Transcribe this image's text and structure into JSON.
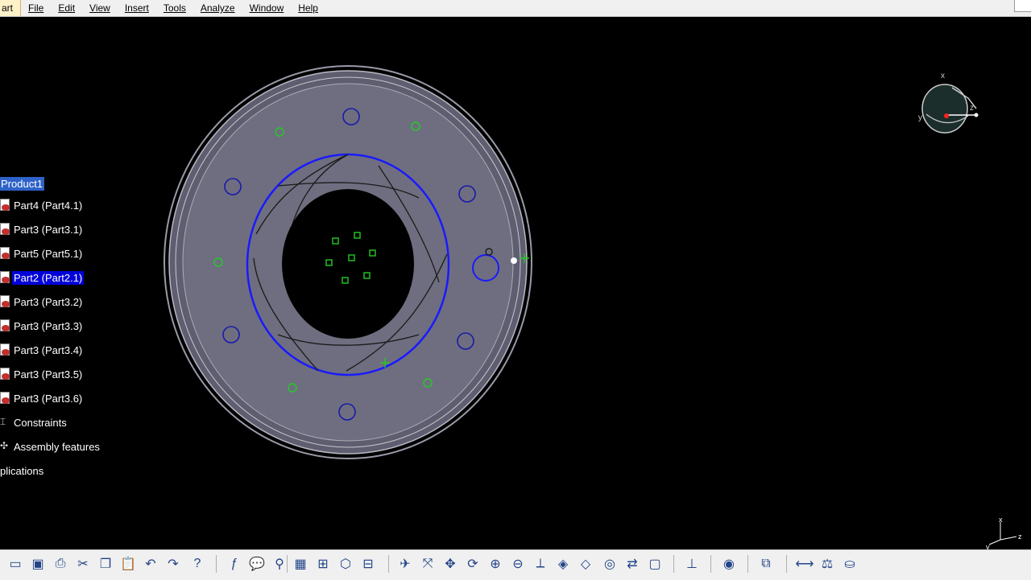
{
  "menu": {
    "items": [
      "art",
      "File",
      "Edit",
      "View",
      "Insert",
      "Tools",
      "Analyze",
      "Window",
      "Help"
    ]
  },
  "tree": {
    "root": "Product1",
    "items": [
      {
        "label": "Part4 (Part4.1)",
        "selected": false
      },
      {
        "label": "Part3 (Part3.1)",
        "selected": false
      },
      {
        "label": "Part5 (Part5.1)",
        "selected": false
      },
      {
        "label": "Part2 (Part2.1)",
        "selected": true
      },
      {
        "label": "Part3 (Part3.2)",
        "selected": false
      },
      {
        "label": "Part3 (Part3.3)",
        "selected": false
      },
      {
        "label": "Part3 (Part3.4)",
        "selected": false
      },
      {
        "label": "Part3 (Part3.5)",
        "selected": false
      },
      {
        "label": "Part3 (Part3.6)",
        "selected": false
      }
    ],
    "constraints": "Constraints",
    "assembly_features": "Assembly features",
    "applications": "plications"
  },
  "compass_labels": {
    "x": "x",
    "y": "y",
    "z": "z"
  },
  "colors": {
    "background": "#000000",
    "part_face": "#6e6e80",
    "selected_outline": "#1a1aff",
    "constraint_green": "#22cc22",
    "selection_highlight": "#0000d8"
  },
  "toolbar": {
    "icons": [
      "open-folder-icon",
      "save-icon",
      "print-icon",
      "cut-icon",
      "copy-icon",
      "paste-icon",
      "undo-icon",
      "redo-icon",
      "whats-this-icon",
      "formula-icon",
      "comment-icon",
      "table-icon",
      "catalog-icon",
      "knowledge-icon",
      "measure-icon",
      "fly-mode-icon",
      "fit-all-icon",
      "pan-icon",
      "rotate-icon",
      "zoom-in-icon",
      "zoom-out-icon",
      "normal-view-icon",
      "iso-view-icon",
      "view-mode-icon",
      "hide-show-icon",
      "swap-space-icon",
      "render-icon",
      "tree-expand-icon",
      "capture-icon",
      "analysis-icon",
      "clash-icon",
      "sectioning-icon",
      "weight-icon"
    ]
  }
}
